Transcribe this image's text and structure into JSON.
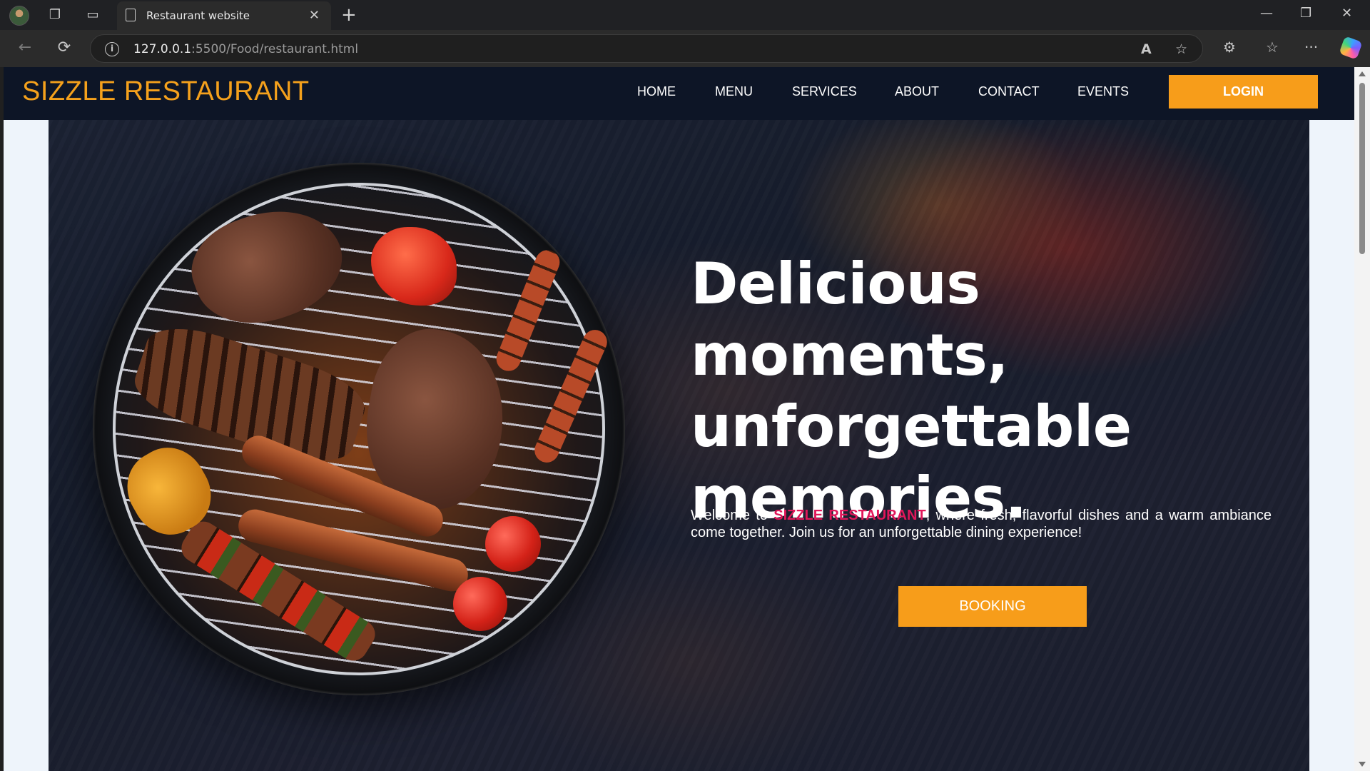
{
  "browser": {
    "tab_title": "Restaurant website",
    "url_host": "127.0.0.1",
    "url_rest": ":5500/Food/restaurant.html",
    "tab_close": "✕",
    "new_tab": "+",
    "icons": {
      "back": "←",
      "refresh": "⟳",
      "read_aloud": "A",
      "favorite": "☆",
      "extensions": "⚙",
      "favorites": "☆",
      "more": "···",
      "minimize": "—",
      "restore": "❐",
      "close": "✕",
      "info": "i"
    }
  },
  "site": {
    "brand": "SIZZLE RESTAURANT",
    "nav": [
      "HOME",
      "MENU",
      "SERVICES",
      "ABOUT",
      "CONTACT",
      "EVENTS"
    ],
    "login": "LOGIN",
    "hero": {
      "headline_1": "Delicious moments,",
      "headline_2": "unforgettable",
      "headline_3": "memories.",
      "intro_before": "Welcome to ",
      "intro_brand": "SIZZLE RESTAURANT",
      "intro_after": ", where fresh, flavorful dishes and a warm ambiance come together. Join us for an unforgettable dining experience!",
      "booking": "BOOKING"
    }
  },
  "colors": {
    "brand_orange": "#f79d1a",
    "nav_bg": "#0d1526",
    "highlight_pink": "#e0175a"
  }
}
